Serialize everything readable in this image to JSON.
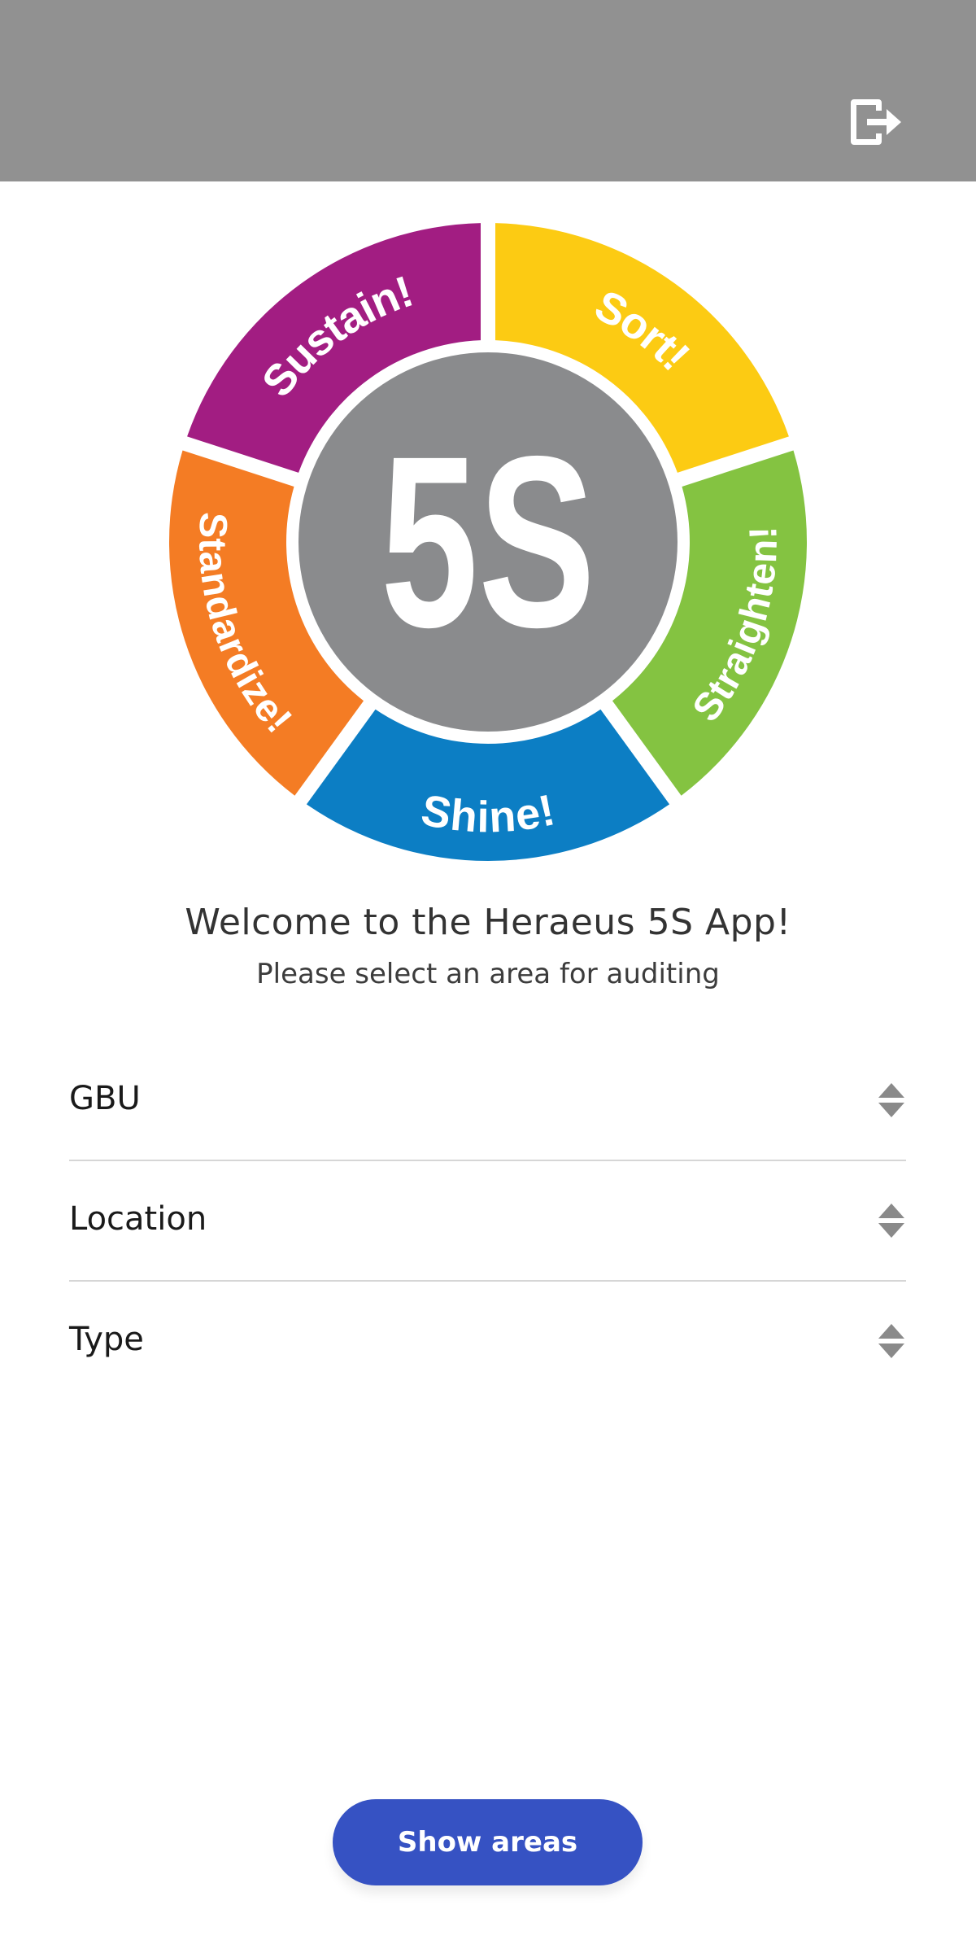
{
  "header": {
    "logout_icon": "logout-icon"
  },
  "logo": {
    "center_text": "5S",
    "segments": [
      {
        "label": "Sort!",
        "color": "#FCCB13"
      },
      {
        "label": "Straighten!",
        "color": "#84C341"
      },
      {
        "label": "Shine!",
        "color": "#0C7EC4"
      },
      {
        "label": "Standardize!",
        "color": "#F47C24"
      },
      {
        "label": "Sustain!",
        "color": "#A21D82"
      }
    ],
    "center_color": "#8A8B8D"
  },
  "welcome": {
    "title": "Welcome to the Heraeus 5S App!",
    "subtitle": "Please select an area for auditing"
  },
  "filters": [
    {
      "label": "GBU"
    },
    {
      "label": "Location"
    },
    {
      "label": "Type"
    }
  ],
  "actions": {
    "show_areas_label": "Show areas"
  },
  "colors": {
    "header_bg": "#919191",
    "primary_button": "#3652C3"
  }
}
